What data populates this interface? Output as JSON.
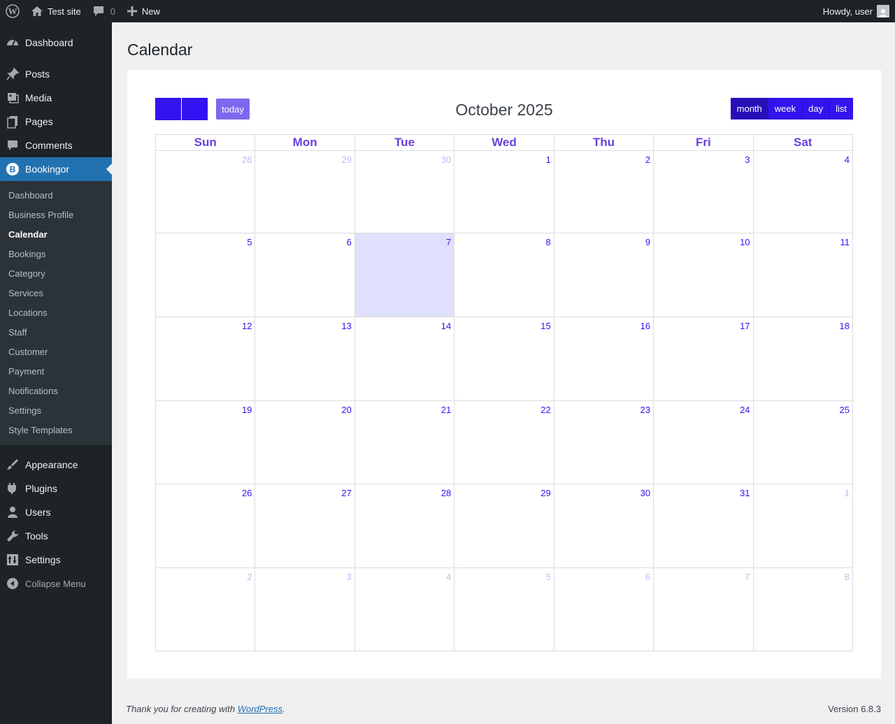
{
  "adminbar": {
    "site_name": "Test site",
    "comments_count": "0",
    "new_label": "New",
    "howdy": "Howdy, user"
  },
  "sidebar": {
    "top_items": [
      {
        "label": "Dashboard",
        "icon": "dashboard-icon"
      }
    ],
    "items": [
      {
        "label": "Posts",
        "icon": "pin-icon"
      },
      {
        "label": "Media",
        "icon": "media-icon"
      },
      {
        "label": "Pages",
        "icon": "pages-icon"
      },
      {
        "label": "Comments",
        "icon": "comment-icon"
      },
      {
        "label": "Bookingor",
        "icon": "bookingor-icon"
      }
    ],
    "submenu": [
      "Dashboard",
      "Business Profile",
      "Calendar",
      "Bookings",
      "Category",
      "Services",
      "Locations",
      "Staff",
      "Customer",
      "Payment",
      "Notifications",
      "Settings",
      "Style Templates"
    ],
    "bottom_items": [
      {
        "label": "Appearance",
        "icon": "brush-icon"
      },
      {
        "label": "Plugins",
        "icon": "plugin-icon"
      },
      {
        "label": "Users",
        "icon": "users-icon"
      },
      {
        "label": "Tools",
        "icon": "wrench-icon"
      },
      {
        "label": "Settings",
        "icon": "settings-icon"
      }
    ],
    "collapse_label": "Collapse Menu"
  },
  "page": {
    "title": "Calendar"
  },
  "calendar": {
    "today_label": "today",
    "title": "October 2025",
    "views": [
      "month",
      "week",
      "day",
      "list"
    ],
    "active_view": "month",
    "days_of_week": [
      "Sun",
      "Mon",
      "Tue",
      "Wed",
      "Thu",
      "Fri",
      "Sat"
    ],
    "weeks": [
      [
        "28",
        "29",
        "30",
        "1",
        "2",
        "3",
        "4"
      ],
      [
        "5",
        "6",
        "7",
        "8",
        "9",
        "10",
        "11"
      ],
      [
        "12",
        "13",
        "14",
        "15",
        "16",
        "17",
        "18"
      ],
      [
        "19",
        "20",
        "21",
        "22",
        "23",
        "24",
        "25"
      ],
      [
        "26",
        "27",
        "28",
        "29",
        "30",
        "31",
        "1"
      ],
      [
        "2",
        "3",
        "4",
        "5",
        "6",
        "7",
        "8"
      ]
    ],
    "today_date": "7",
    "colors": {
      "primary": "#3214f2",
      "today_button": "#7b68ee",
      "header_text": "#6a3fe0",
      "today_bg": "#dfe0fb",
      "other_month": "#c4baf5"
    }
  },
  "footer": {
    "thanks_prefix": "Thank you for creating with ",
    "link_text": "WordPress",
    "thanks_suffix": ".",
    "version": "Version 6.8.3"
  }
}
